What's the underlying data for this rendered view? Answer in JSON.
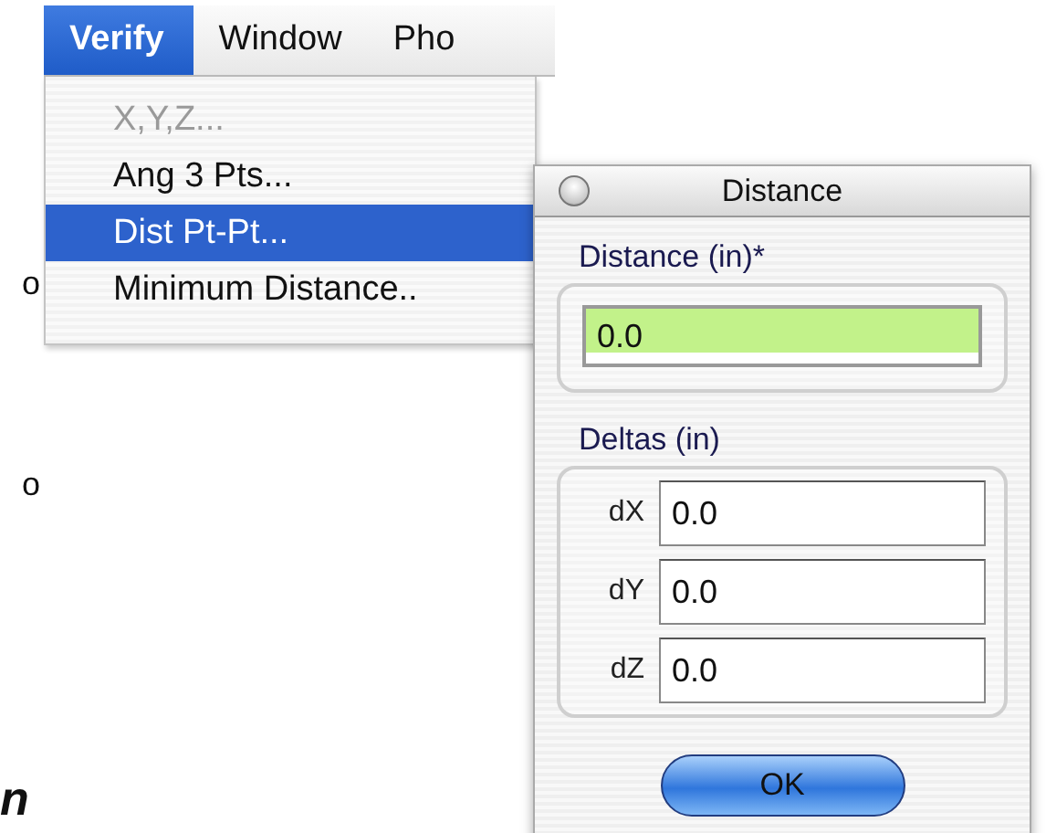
{
  "page_text": [
    {
      "text": "o",
      "kind": "body"
    },
    {
      "text": "o",
      "kind": "body"
    },
    {
      "text": "n",
      "kind": "heading"
    }
  ],
  "menu_bar": {
    "items": [
      {
        "label": "Verify",
        "selected": true
      },
      {
        "label": "Window",
        "selected": false
      },
      {
        "label": "Pho",
        "selected": false
      }
    ]
  },
  "menu": {
    "items": [
      {
        "label": "X,Y,Z...",
        "disabled": true,
        "selected": false
      },
      {
        "label": "Ang 3 Pts...",
        "disabled": false,
        "selected": false
      },
      {
        "label": "Dist Pt-Pt...",
        "disabled": false,
        "selected": true
      },
      {
        "label": "Minimum Distance..",
        "disabled": false,
        "selected": false
      }
    ]
  },
  "dialog": {
    "title": "Distance",
    "distance": {
      "label": "Distance (in)*",
      "value": "0.0",
      "highlighted": true
    },
    "deltas": {
      "label": "Deltas (in)",
      "fields": [
        {
          "label": "dX",
          "value": "0.0"
        },
        {
          "label": "dY",
          "value": "0.0"
        },
        {
          "label": "dZ",
          "value": "0.0"
        }
      ]
    },
    "buttons": [
      "OK"
    ]
  }
}
